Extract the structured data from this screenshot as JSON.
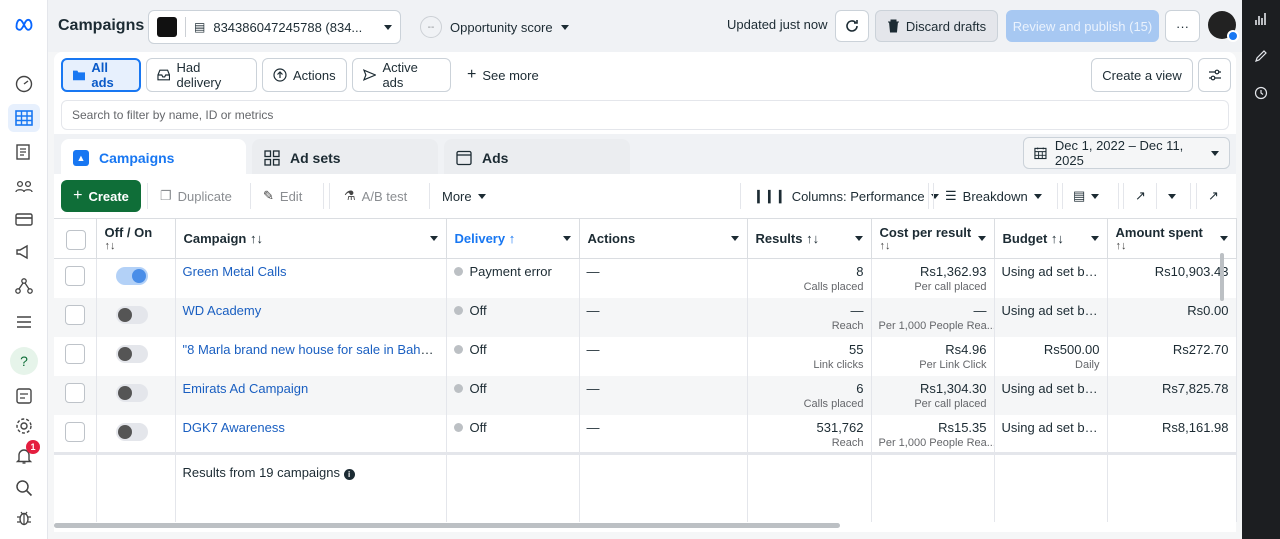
{
  "colors": {
    "accent": "#1877f2",
    "create": "#0f6e38",
    "badge": "#e41e3f"
  },
  "topbar": {
    "title": "Campaigns",
    "account": "834386047245788 (834...",
    "opportunity": "Opportunity score",
    "opportunity_icon": "--",
    "updated": "Updated just now",
    "discard": "Discard drafts",
    "review": "Review and publish (15)",
    "more": "···"
  },
  "leftnav": {
    "notification_count": "1"
  },
  "filters": {
    "all_ads": "All ads",
    "had_delivery": "Had delivery",
    "actions": "Actions",
    "active_ads": "Active ads",
    "see_more": "See more",
    "create_view": "Create a view"
  },
  "search": {
    "placeholder": "Search to filter by name, ID or metrics"
  },
  "tabs": {
    "campaigns": "Campaigns",
    "ad_sets": "Ad sets",
    "ads": "Ads"
  },
  "date_range": "Dec 1, 2022 – Dec 11, 2025",
  "toolbar": {
    "create": "Create",
    "duplicate": "Duplicate",
    "edit": "Edit",
    "ab_test": "A/B test",
    "more": "More",
    "columns": "Columns: Performance",
    "breakdown": "Breakdown"
  },
  "columns": {
    "off_on": "Off / On",
    "campaign": "Campaign",
    "delivery": "Delivery",
    "actions": "Actions",
    "results": "Results",
    "cost_per_result": "Cost per result",
    "budget": "Budget",
    "amount_spent": "Amount spent",
    "sort_icon": "↑↓",
    "sort_asc_icon": "↑"
  },
  "rows": [
    {
      "on": true,
      "name": "Green Metal Calls",
      "delivery": "Payment error",
      "actions": "—",
      "results": "8",
      "results_sub": "Calls placed",
      "cost": "Rs1,362.93",
      "cost_sub": "Per call placed",
      "budget": "Using ad set bu...",
      "budget_sub": "",
      "spent": "Rs10,903.43"
    },
    {
      "on": false,
      "name": "WD Academy",
      "delivery": "Off",
      "actions": "—",
      "results": "—",
      "results_sub": "Reach",
      "cost": "—",
      "cost_sub": "Per 1,000 People Rea...",
      "budget": "Using ad set bu...",
      "budget_sub": "",
      "spent": "Rs0.00"
    },
    {
      "on": false,
      "name": "\"8 Marla brand new house for sale in Bahadur ...",
      "delivery": "Off",
      "actions": "—",
      "results": "55",
      "results_sub": "Link clicks",
      "cost": "Rs4.96",
      "cost_sub": "Per Link Click",
      "budget": "Rs500.00",
      "budget_sub": "Daily",
      "spent": "Rs272.70"
    },
    {
      "on": false,
      "name": "Emirats Ad Campaign",
      "delivery": "Off",
      "actions": "—",
      "results": "6",
      "results_sub": "Calls placed",
      "cost": "Rs1,304.30",
      "cost_sub": "Per call placed",
      "budget": "Using ad set bu...",
      "budget_sub": "",
      "spent": "Rs7,825.78"
    },
    {
      "on": false,
      "name": "DGK7 Awareness",
      "delivery": "Off",
      "actions": "—",
      "results": "531,762",
      "results_sub": "Reach",
      "cost": "Rs15.35",
      "cost_sub": "Per 1,000 People Rea...",
      "budget": "Using ad set bu...",
      "budget_sub": "",
      "spent": "Rs8,161.98"
    }
  ],
  "summary": {
    "text": "Results from 19 campaigns"
  }
}
